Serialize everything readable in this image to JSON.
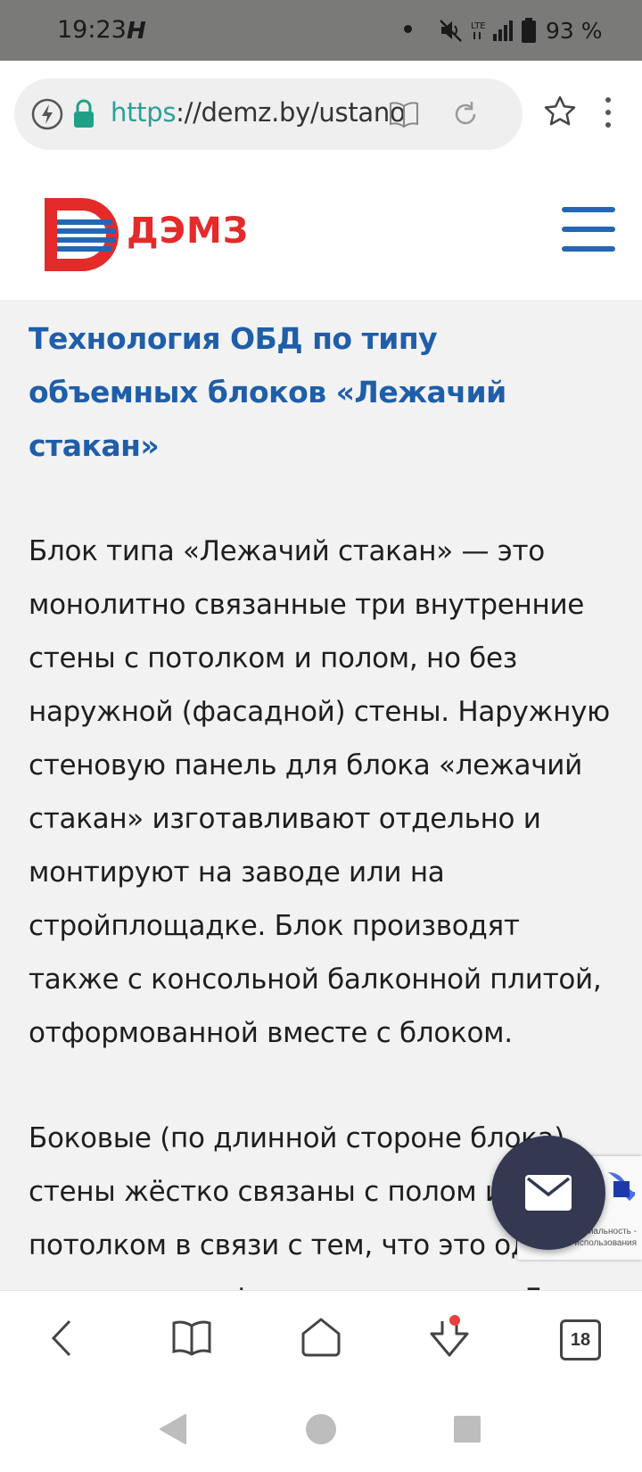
{
  "status_bar": {
    "time": "19:23",
    "carrier_glyph": "H",
    "battery": "93 %",
    "icons": [
      "mute-icon",
      "lte-icon",
      "signal-icon",
      "battery-icon"
    ]
  },
  "browser": {
    "url_scheme": "https",
    "url_rest": "://demz.by/ustanovl",
    "icons": [
      "lightning-icon",
      "lock-icon",
      "reader-icon",
      "reload-icon",
      "star-icon",
      "menu-dots-icon"
    ]
  },
  "site": {
    "logo_text": "ДЭМЗ",
    "brand_red": "#e52a2a",
    "brand_blue": "#2367b4"
  },
  "article": {
    "heading": "Технология ОБД по типу объемных блоков «Лежачий стакан»",
    "paragraphs": [
      "Блок типа «Лежачий стакан» — это монолитно связанные три внутренние стены с потолком и полом, но без наружной (фасадной) стены. Наружную стеновую панель для блока «лежачий стакан» изготавливают отдельно и монтируют на заводе или на стройплощадке. Блок производят также с консольной балконной плитой, отформованной вместе с блоком.",
      "Боковые (по длинной стороне блока) стены жёстко связаны с полом и потолком в связи с тем, что это одна конструкция, формуемая за один Для выполнения распалубки"
    ]
  },
  "recaptcha": {
    "text_line1": "иальность -",
    "text_line2": "Условия использования"
  },
  "toolbar": {
    "tab_count": "18",
    "icons": [
      "back-icon",
      "bookmarks-icon",
      "home-icon",
      "downloads-icon",
      "tabs-icon"
    ]
  },
  "nav": {
    "icons": [
      "nav-back-icon",
      "nav-home-icon",
      "nav-recents-icon"
    ]
  }
}
